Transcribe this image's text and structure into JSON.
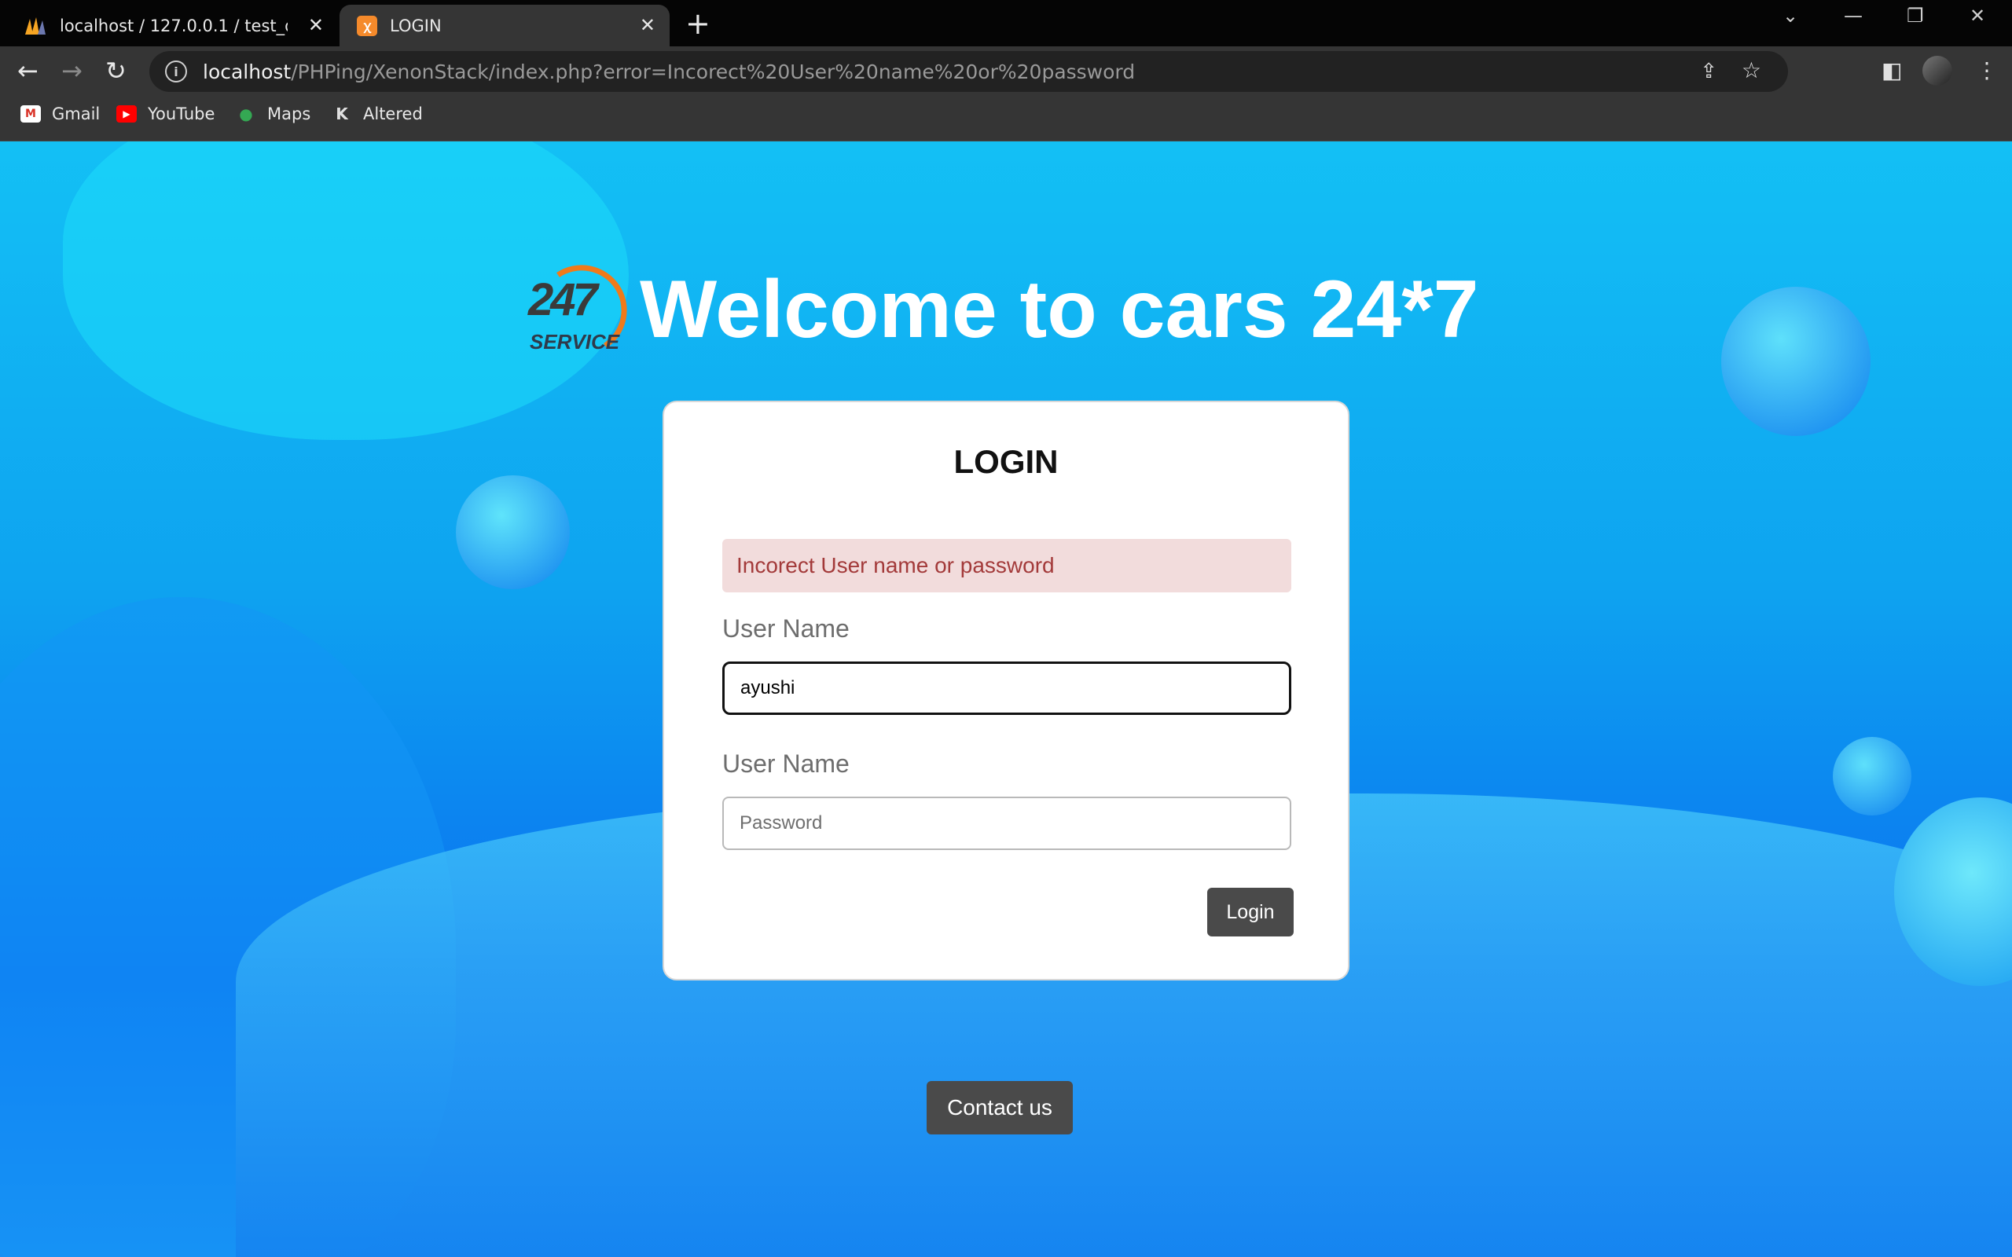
{
  "browser": {
    "tabs": [
      {
        "title": "localhost / 127.0.0.1 / test_db / u",
        "active": false,
        "icon": "phpmyadmin-icon"
      },
      {
        "title": "LOGIN",
        "active": true,
        "icon": "xampp-icon"
      }
    ],
    "new_tab": "+",
    "url_host": "localhost",
    "url_path": "/PHPing/XenonStack/index.php?error=Incorect%20User%20name%20or%20password",
    "bookmarks": [
      {
        "label": "Gmail",
        "icon": "gmail-icon"
      },
      {
        "label": "YouTube",
        "icon": "youtube-icon"
      },
      {
        "label": "Maps",
        "icon": "maps-icon"
      },
      {
        "label": "Altered",
        "icon": "altered-icon"
      }
    ]
  },
  "page": {
    "logo_top": "247",
    "logo_bottom": "SERVICE",
    "welcome": "Welcome to cars 24*7",
    "login_title": "LOGIN",
    "error": "Incorect User name or password",
    "username_label": "User Name",
    "username_value": "ayushi",
    "password_label": "User Name",
    "password_placeholder": "Password",
    "login_button": "Login",
    "contact_button": "Contact us"
  },
  "colors": {
    "background_top": "#13c0f5",
    "background_bottom": "#0a6ff0",
    "error_bg": "#f2dcdc",
    "error_text": "#a33a3a",
    "button": "#4a4a4a",
    "logo_orange": "#f07a1a"
  }
}
